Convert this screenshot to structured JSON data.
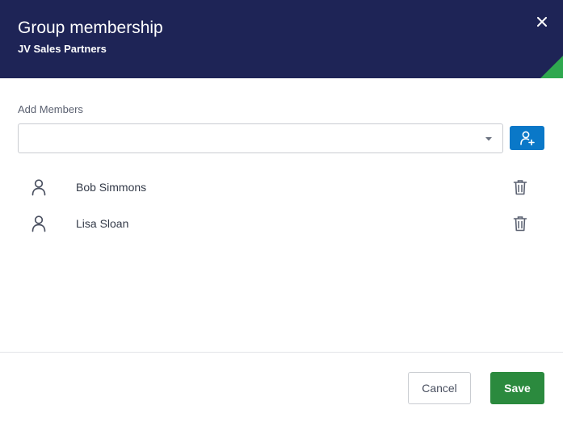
{
  "dialog": {
    "title": "Group membership",
    "subtitle": "JV Sales Partners",
    "close_icon": "close-icon"
  },
  "add_members": {
    "label": "Add Members",
    "selected_value": "",
    "dropdown_icon": "chevron-down-icon",
    "add_button_icon": "add-user-icon"
  },
  "members": [
    {
      "name": "Bob Simmons",
      "icon": "user-icon",
      "action_icon": "trash-icon"
    },
    {
      "name": "Lisa Sloan",
      "icon": "user-icon",
      "action_icon": "trash-icon"
    }
  ],
  "footer": {
    "cancel_label": "Cancel",
    "save_label": "Save"
  },
  "colors": {
    "header_background": "#1e2456",
    "accent_corner": "#2fa84f",
    "primary_button": "#0a78c8",
    "save_button": "#2b8a3e"
  }
}
